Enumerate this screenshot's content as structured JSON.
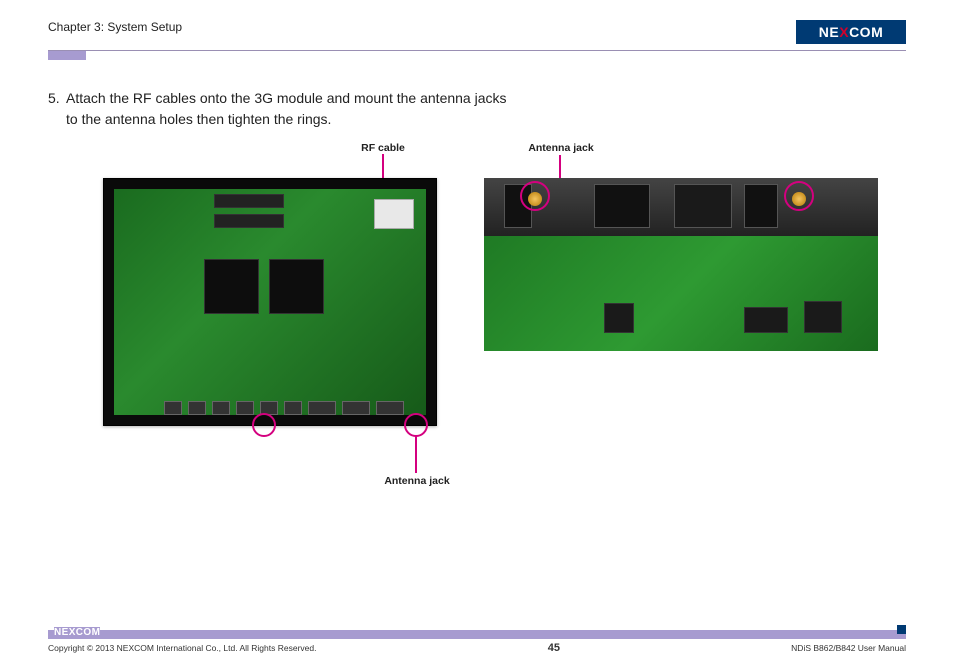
{
  "header": {
    "chapter": "Chapter 3: System Setup",
    "logo_pre": "NE",
    "logo_x": "X",
    "logo_post": "COM"
  },
  "instruction": {
    "number": "5.",
    "text_line1": "Attach the RF cables onto the 3G module and mount the antenna jacks",
    "text_line2": "to the antenna holes then tighten the rings."
  },
  "labels": {
    "rf_cable": "RF cable",
    "antenna_jack_top": "Antenna jack",
    "antenna_jack_bottom": "Antenna jack"
  },
  "footer": {
    "copyright": "Copyright © 2013 NEXCOM International Co., Ltd. All Rights Reserved.",
    "page_number": "45",
    "manual": "NDiS B862/B842 User Manual",
    "logo_pre": "NE",
    "logo_x": "X",
    "logo_post": "COM"
  }
}
